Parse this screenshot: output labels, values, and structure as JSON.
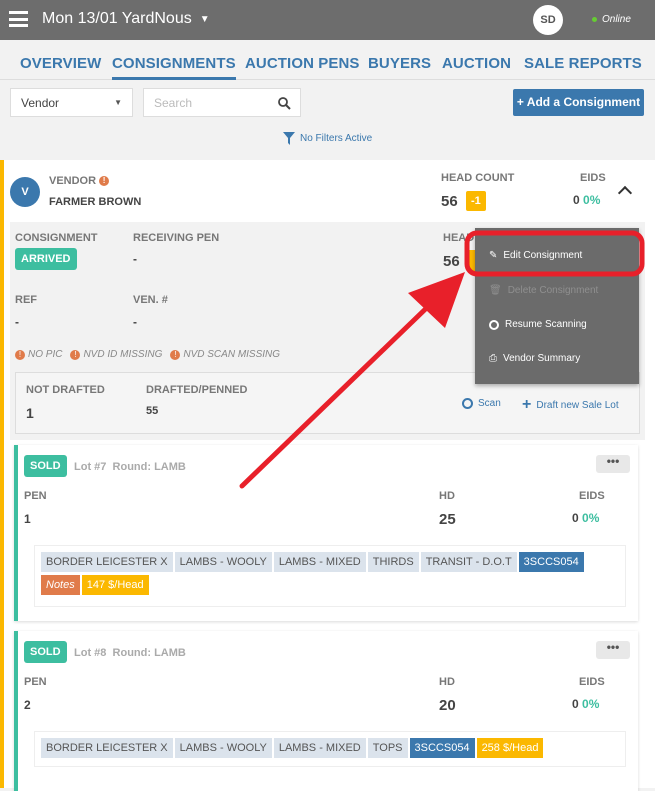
{
  "header": {
    "title": "Mon 13/01 YardNous",
    "avatar": "SD",
    "status": "Online"
  },
  "tabs": [
    "OVERVIEW",
    "CONSIGNMENTS",
    "AUCTION PENS",
    "BUYERS",
    "AUCTION",
    "SALE REPORTS"
  ],
  "filters": {
    "select": "Vendor",
    "search_placeholder": "Search",
    "add_button": "+ Add a Consignment",
    "filter_status": "No Filters Active"
  },
  "vendor": {
    "avatar": "V",
    "label": "VENDOR",
    "name": "FARMER BROWN",
    "headcount_label": "HEAD COUNT",
    "headcount": "56",
    "headcount_diff": "-1",
    "eids_label": "EIDS",
    "eids": "0",
    "eids_pct": "0%"
  },
  "consignment": {
    "label": "CONSIGNMENT",
    "status": "ARRIVED",
    "receiving_pen_label": "RECEIVING PEN",
    "receiving_pen": "-",
    "head_label": "HEAD",
    "head": "56",
    "ref_label": "REF",
    "ref": "-",
    "ven_label": "VEN. #",
    "ven": "-",
    "warnings": [
      "NO PIC",
      "NVD ID MISSING",
      "NVD SCAN MISSING"
    ],
    "not_drafted_label": "NOT DRAFTED",
    "not_drafted": "1",
    "drafted_label": "DRAFTED/PENNED",
    "drafted": "55",
    "scan": "Scan",
    "draft_new": "Draft new Sale Lot"
  },
  "menu": {
    "items": [
      "Edit Consignment",
      "Delete Consignment",
      "Resume Scanning",
      "Vendor Summary"
    ]
  },
  "lots": [
    {
      "status": "SOLD",
      "lot": "Lot #7",
      "round": "Round: LAMB",
      "pen_label": "PEN",
      "pen": "1",
      "hd_label": "HD",
      "hd": "25",
      "eids_label": "EIDS",
      "eids": "0",
      "eids_pct": "0%",
      "tags": [
        "BORDER LEICESTER X",
        "LAMBS - WOOLY",
        "LAMBS - MIXED",
        "THIRDS",
        "TRANSIT - D.O.T"
      ],
      "code": "3SCCS054",
      "notes": "Notes",
      "price": "147 $/Head"
    },
    {
      "status": "SOLD",
      "lot": "Lot #8",
      "round": "Round: LAMB",
      "pen_label": "PEN",
      "pen": "2",
      "hd_label": "HD",
      "hd": "20",
      "eids_label": "EIDS",
      "eids": "0",
      "eids_pct": "0%",
      "tags": [
        "BORDER LEICESTER X",
        "LAMBS - WOOLY",
        "LAMBS - MIXED",
        "TOPS"
      ],
      "code": "3SCCS054",
      "price": "258 $/Head"
    }
  ],
  "colors": {
    "header": "#6d6d6d",
    "accent": "#3b78ad",
    "teal": "#3dbea0",
    "yellow": "#fbb800",
    "orange": "#e07b4a",
    "annotation": "#e8202a"
  }
}
